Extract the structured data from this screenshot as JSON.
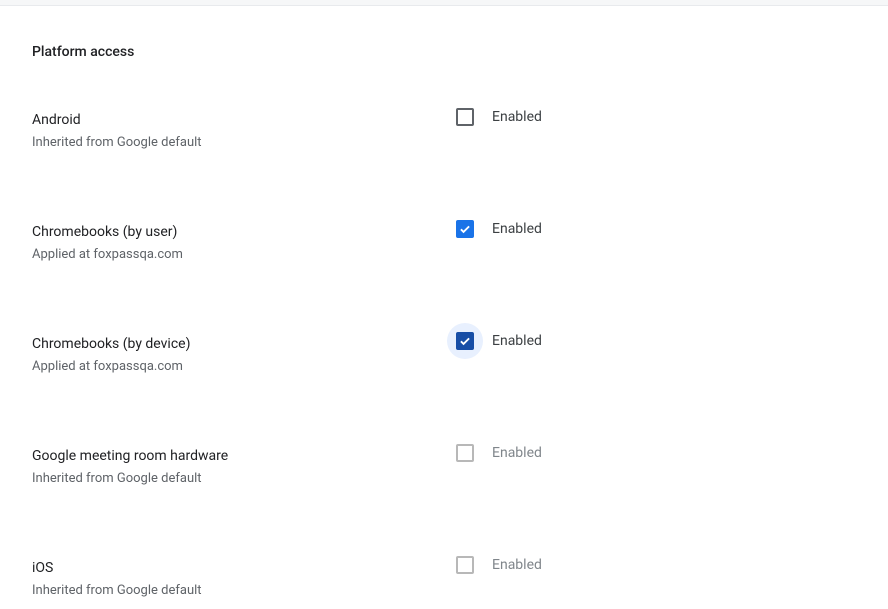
{
  "section_title": "Platform access",
  "rows": [
    {
      "title": "Android",
      "subtitle": "Inherited from Google default",
      "check_label": "Enabled",
      "checked": false,
      "halo": false,
      "checkbox_style": "normal",
      "label_disabled": false
    },
    {
      "title": "Chromebooks (by user)",
      "subtitle": "Applied at foxpassqa.com",
      "check_label": "Enabled",
      "checked": true,
      "halo": false,
      "checkbox_style": "checked-blue",
      "label_disabled": false
    },
    {
      "title": "Chromebooks (by device)",
      "subtitle": "Applied at foxpassqa.com",
      "check_label": "Enabled",
      "checked": true,
      "halo": true,
      "checkbox_style": "checked-dark",
      "label_disabled": false
    },
    {
      "title": "Google meeting room hardware",
      "subtitle": "Inherited from Google default",
      "check_label": "Enabled",
      "checked": false,
      "halo": false,
      "checkbox_style": "disabled",
      "label_disabled": true
    },
    {
      "title": "iOS",
      "subtitle": "Inherited from Google default",
      "check_label": "Enabled",
      "checked": false,
      "halo": false,
      "checkbox_style": "disabled",
      "label_disabled": true
    }
  ]
}
